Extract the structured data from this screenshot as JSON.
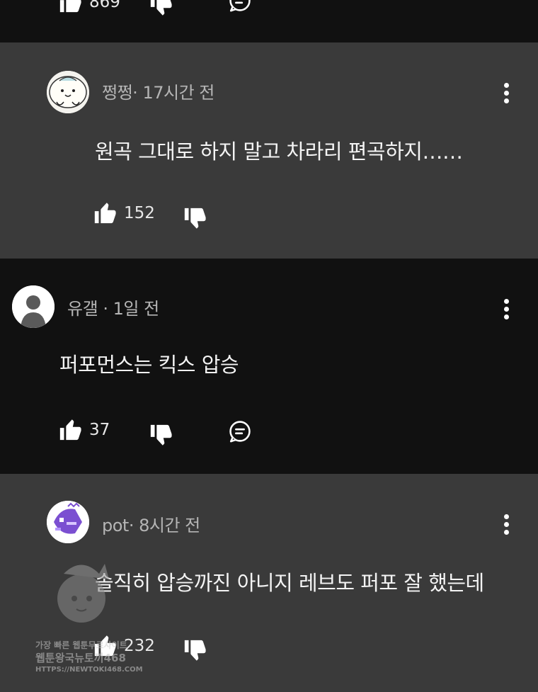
{
  "top_partial": {
    "like_count": "869"
  },
  "comments": [
    {
      "author": "쩡쩡",
      "time": "17시간 전",
      "text": "원곡 그대로 하지 말고 차라리 편곡하지……",
      "likes": "152",
      "is_reply": true
    },
    {
      "author": "유갤",
      "time": "1일 전",
      "text": "퍼포먼스는 킥스 압승",
      "likes": "37",
      "is_reply": false
    },
    {
      "author": "pot",
      "time": "8시간 전",
      "text": "솔직히 압승까진 아니지 레브도 퍼포 잘 했는데",
      "likes": "232",
      "is_reply": true
    }
  ],
  "meta_separator": "·",
  "watermark": {
    "line1": "가장 빠른 웹툰무료사이트",
    "line2": "웹툰왕국뉴토끼468",
    "line3": "HTTPS://NEWTOKI468.COM"
  },
  "colors": {
    "background": "#111111",
    "reply_background": "#3a3a3a",
    "meta_text": "#b5b5b5",
    "text": "#f4f4f4"
  },
  "icons": {
    "like": "thumbs-up-icon",
    "dislike": "thumbs-down-icon",
    "reply": "comment-bubble-icon",
    "more": "more-vertical-icon"
  }
}
